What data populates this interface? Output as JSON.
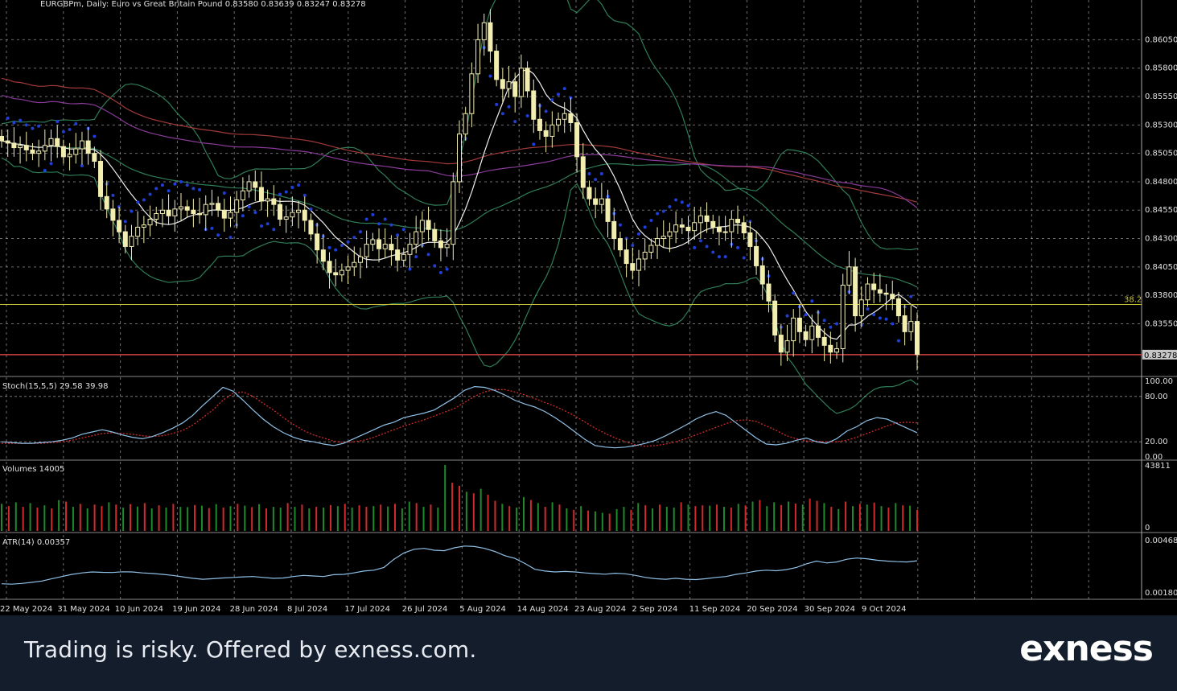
{
  "header": {
    "symbol_info": "EURGBPm, Daily:  Euro vs Great Britain Pound  0.83580 0.83639 0.83247 0.83278"
  },
  "footer": {
    "disclaimer": "Trading is risky. Offered by exness.com.",
    "logo": "exness"
  },
  "colors": {
    "background": "#000000",
    "grid": "#c8c8c8",
    "bull_candle": "#f2eeb0",
    "bear_candle": "#f2eeb0",
    "sma_fast": "#f0f0f0",
    "bollinger": "#2f7d57",
    "ma_red": "#a23a3a",
    "ma_purple": "#8a3a9a",
    "psar": "#1f3fd9",
    "fib_line": "#c8c23a",
    "price_line": "#d04040",
    "stoch_main": "#8fc0e6",
    "stoch_signal": "#d02a2a",
    "vol_up": "#1f8a2a",
    "vol_down": "#d02a2a",
    "atr": "#8fc0e6",
    "footer_bg": "#141d2b"
  },
  "chart_data": [
    {
      "type": "candlestick",
      "panel": "price",
      "x_labels": [
        "22 May 2024",
        "31 May 2024",
        "10 Jun 2024",
        "19 Jun 2024",
        "28 Jun 2024",
        "8 Jul 2024",
        "17 Jul 2024",
        "26 Jul 2024",
        "5 Aug 2024",
        "14 Aug 2024",
        "23 Aug 2024",
        "2 Sep 2024",
        "11 Sep 2024",
        "20 Sep 2024",
        "30 Sep 2024",
        "9 Oct 2024"
      ],
      "y_ticks": [
        "0.86050",
        "0.85800",
        "0.85550",
        "0.85300",
        "0.85050",
        "0.84800",
        "0.84550",
        "0.84300",
        "0.84050",
        "0.83800",
        "0.83550"
      ],
      "y_range": [
        0.831,
        0.864
      ],
      "last_price_label": "0.83278",
      "last_price": 0.83278,
      "fib_level_label": "38.2",
      "fib_level": 0.8372,
      "closes": [
        0.8516,
        0.8514,
        0.851,
        0.8512,
        0.8508,
        0.8505,
        0.8507,
        0.8512,
        0.8518,
        0.8511,
        0.8502,
        0.8504,
        0.8509,
        0.8516,
        0.8505,
        0.8498,
        0.8467,
        0.8456,
        0.8446,
        0.8436,
        0.8423,
        0.8432,
        0.844,
        0.8442,
        0.8447,
        0.8452,
        0.8455,
        0.845,
        0.8456,
        0.8458,
        0.8455,
        0.8452,
        0.8451,
        0.846,
        0.8461,
        0.8455,
        0.8448,
        0.8453,
        0.8464,
        0.8472,
        0.848,
        0.8475,
        0.8463,
        0.8465,
        0.846,
        0.8447,
        0.8449,
        0.8453,
        0.8455,
        0.8446,
        0.8434,
        0.842,
        0.841,
        0.84,
        0.8398,
        0.8402,
        0.8405,
        0.8409,
        0.8414,
        0.8425,
        0.8429,
        0.8421,
        0.8425,
        0.842,
        0.8411,
        0.8416,
        0.8425,
        0.8436,
        0.8446,
        0.8438,
        0.8428,
        0.8422,
        0.8425,
        0.848,
        0.8522,
        0.854,
        0.8575,
        0.8605,
        0.862,
        0.8595,
        0.857,
        0.8562,
        0.8568,
        0.8555,
        0.858,
        0.856,
        0.8535,
        0.8525,
        0.852,
        0.853,
        0.8535,
        0.854,
        0.8532,
        0.8502,
        0.8475,
        0.8465,
        0.846,
        0.8465,
        0.8445,
        0.843,
        0.842,
        0.8408,
        0.8402,
        0.8412,
        0.8418,
        0.8424,
        0.843,
        0.8432,
        0.8436,
        0.8442,
        0.844,
        0.8437,
        0.8444,
        0.845,
        0.8445,
        0.844,
        0.8436,
        0.8436,
        0.8447,
        0.8444,
        0.8435,
        0.8423,
        0.8406,
        0.839,
        0.8375,
        0.8345,
        0.833,
        0.834,
        0.836,
        0.8348,
        0.8341,
        0.8353,
        0.8343,
        0.8336,
        0.833,
        0.8333,
        0.8389,
        0.8405,
        0.8362,
        0.8376,
        0.839,
        0.8385,
        0.8382,
        0.8381,
        0.8377,
        0.8362,
        0.8348,
        0.8357,
        0.8328
      ]
    },
    {
      "type": "line",
      "panel": "stochastic",
      "label": "Stoch(15,5,5) 29.58 39.98",
      "y_ticks": [
        "100.00",
        "80.00",
        "20.00",
        "0.00"
      ],
      "y_range": [
        0,
        100
      ],
      "series": [
        {
          "name": "main",
          "values": [
            20,
            19,
            18,
            18,
            19,
            20,
            22,
            25,
            30,
            33,
            36,
            33,
            29,
            26,
            24,
            27,
            32,
            38,
            45,
            55,
            68,
            80,
            92,
            87,
            75,
            62,
            50,
            40,
            32,
            26,
            22,
            20,
            17,
            15,
            18,
            24,
            30,
            36,
            42,
            46,
            52,
            55,
            58,
            62,
            70,
            78,
            88,
            93,
            92,
            88,
            82,
            75,
            70,
            66,
            60,
            52,
            43,
            33,
            23,
            15,
            13,
            12,
            13,
            15,
            18,
            22,
            28,
            35,
            42,
            50,
            56,
            60,
            55,
            45,
            35,
            25,
            17,
            16,
            18,
            22,
            25,
            20,
            18,
            24,
            34,
            40,
            48,
            52,
            50,
            44,
            38,
            32
          ]
        },
        {
          "name": "signal",
          "values": [
            18,
            18,
            18,
            18,
            18,
            19,
            20,
            22,
            25,
            28,
            31,
            32,
            31,
            30,
            28,
            27,
            28,
            31,
            35,
            42,
            52,
            62,
            75,
            84,
            86,
            80,
            71,
            62,
            52,
            43,
            35,
            29,
            25,
            21,
            19,
            20,
            22,
            26,
            31,
            36,
            41,
            45,
            49,
            54,
            59,
            64,
            72,
            80,
            86,
            89,
            89,
            86,
            82,
            77,
            72,
            67,
            61,
            54,
            46,
            38,
            31,
            25,
            20,
            16,
            14,
            15,
            17,
            20,
            24,
            29,
            34,
            39,
            44,
            48,
            49,
            47,
            41,
            35,
            28,
            24,
            21,
            21,
            20,
            20,
            22,
            26,
            31,
            36,
            41,
            45,
            46,
            45
          ]
        }
      ]
    },
    {
      "type": "bar",
      "panel": "volume",
      "label": "Volumes 14005",
      "y_ticks": [
        "43811",
        "0"
      ],
      "y_range": [
        0,
        43811
      ],
      "values": [
        18000,
        16500,
        19000,
        16000,
        18500,
        15500,
        17000,
        15000,
        20500,
        19500,
        16000,
        18000,
        15000,
        17500,
        16500,
        19000,
        17500,
        15500,
        17800,
        16200,
        18500,
        15000,
        17000,
        15500,
        18000,
        16000,
        15800,
        17200,
        16800,
        15200,
        17800,
        15500,
        16500,
        18000,
        16800,
        15800,
        17800,
        15000,
        16000,
        15500,
        18500,
        16000,
        17500,
        15000,
        16000,
        15500,
        17200,
        16500,
        18000,
        15500,
        17000,
        16000,
        16500,
        17500,
        16200,
        18000,
        15000,
        19500,
        18500,
        16000,
        17500,
        15500,
        43811,
        32000,
        30000,
        26000,
        25000,
        28000,
        24000,
        20000,
        18000,
        16500,
        15500,
        22500,
        20500,
        18500,
        16000,
        19000,
        17500,
        15000,
        14000,
        16500,
        13500,
        13000,
        12000,
        11500,
        14500,
        16000,
        14000,
        18500,
        17000,
        15000,
        17500,
        16000,
        15500,
        19000,
        17500,
        16500,
        17000,
        16800,
        17500,
        16000,
        15500,
        18000,
        17000,
        19500,
        20500,
        16500,
        19000,
        17200,
        19500,
        18200,
        17500,
        21500,
        20000,
        18500,
        16000,
        14500,
        19500,
        16500,
        18000,
        17500,
        18800,
        16500,
        15500,
        18500,
        17000,
        16800,
        14005
      ],
      "directions": [
        "u",
        "d",
        "u",
        "d",
        "u",
        "d",
        "u",
        "d",
        "u",
        "d",
        "u",
        "d",
        "u",
        "d",
        "d",
        "u",
        "d",
        "u",
        "d",
        "u",
        "d",
        "u",
        "d",
        "u",
        "d",
        "u",
        "u",
        "d",
        "u",
        "d",
        "u",
        "d",
        "u",
        "d",
        "u",
        "d",
        "u",
        "d",
        "u",
        "u",
        "d",
        "u",
        "d",
        "u",
        "d",
        "u",
        "d",
        "u",
        "d",
        "u",
        "d",
        "d",
        "u",
        "d",
        "u",
        "d",
        "u",
        "u",
        "d",
        "u",
        "d",
        "u",
        "u",
        "d",
        "d",
        "u",
        "d",
        "u",
        "d",
        "d",
        "u",
        "d",
        "u",
        "u",
        "d",
        "u",
        "d",
        "u",
        "d",
        "u",
        "d",
        "u",
        "d",
        "u",
        "u",
        "d",
        "u",
        "u",
        "d",
        "u",
        "d",
        "u",
        "d",
        "u",
        "u",
        "d",
        "u",
        "d",
        "d",
        "u",
        "d",
        "u",
        "d",
        "u",
        "d",
        "u",
        "d",
        "u",
        "u",
        "d",
        "u",
        "d",
        "u",
        "d",
        "d",
        "u",
        "d",
        "u",
        "d",
        "u",
        "d",
        "u",
        "d",
        "u",
        "d",
        "u",
        "d",
        "u",
        "d"
      ]
    },
    {
      "type": "line",
      "panel": "atr",
      "label": "ATR(14) 0.00357",
      "y_ticks": [
        "0.00468",
        "0.00180"
      ],
      "y_range": [
        0.0018,
        0.00468
      ],
      "values": [
        0.0023,
        0.00228,
        0.00232,
        0.00238,
        0.00245,
        0.00258,
        0.0027,
        0.00282,
        0.0029,
        0.00295,
        0.00293,
        0.00292,
        0.00296,
        0.00295,
        0.0029,
        0.00287,
        0.00282,
        0.00276,
        0.00268,
        0.0026,
        0.00255,
        0.00258,
        0.00262,
        0.00265,
        0.00268,
        0.0027,
        0.00265,
        0.0026,
        0.00262,
        0.0027,
        0.00276,
        0.00273,
        0.0027,
        0.0028,
        0.00282,
        0.0029,
        0.003,
        0.00305,
        0.0032,
        0.00365,
        0.004,
        0.0042,
        0.00425,
        0.00415,
        0.00412,
        0.00428,
        0.00438,
        0.00435,
        0.00425,
        0.00408,
        0.00385,
        0.0037,
        0.00342,
        0.0031,
        0.003,
        0.00295,
        0.00298,
        0.00295,
        0.0029,
        0.00286,
        0.00283,
        0.00288,
        0.00285,
        0.00276,
        0.00265,
        0.00258,
        0.00255,
        0.0026,
        0.00255,
        0.00253,
        0.00258,
        0.00265,
        0.0027,
        0.00282,
        0.0029,
        0.003,
        0.00305,
        0.00302,
        0.00308,
        0.0032,
        0.0034,
        0.00355,
        0.00345,
        0.0035,
        0.00365,
        0.00372,
        0.00368,
        0.0036,
        0.00355,
        0.00352,
        0.0035,
        0.00357
      ]
    }
  ]
}
